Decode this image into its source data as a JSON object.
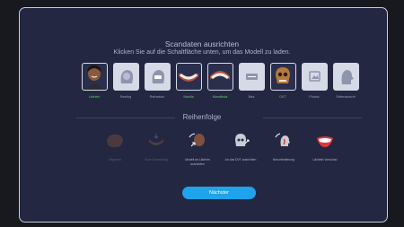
{
  "header": {
    "title": "Scandaten ausrichten",
    "subtitle": "Klicken Sie auf die Schaltfläche unten, um das Modell zu laden."
  },
  "tiles": [
    {
      "label": "Lächeln",
      "color": "#5fd06a",
      "icon": "face-photo-icon"
    },
    {
      "label": "Resting",
      "color": "#9aa0ba",
      "icon": "head-profile-icon"
    },
    {
      "label": "Retraction",
      "color": "#9aa0ba",
      "icon": "retracted-teeth-icon"
    },
    {
      "label": "Maxilla",
      "color": "#5fd06a",
      "icon": "maxilla-scan-icon"
    },
    {
      "label": "Mandibula",
      "color": "#5fd06a",
      "icon": "mandibula-scan-icon"
    },
    {
      "label": "Biss",
      "color": "#9aa0ba",
      "icon": "bite-icon"
    },
    {
      "label": "DVT",
      "color": "#5fd06a",
      "icon": "dvt-skull-icon"
    },
    {
      "label": "Photos",
      "color": "#9aa0ba",
      "icon": "photo-icon"
    },
    {
      "label": "Seitenansicht",
      "color": "#9aa0ba",
      "icon": "side-view-icon"
    }
  ],
  "order": {
    "title": "Reihenfolge",
    "steps": [
      {
        "label": "Segment",
        "dim": true,
        "icon": "segment-icon"
      },
      {
        "label": "Scan Einrichtung",
        "dim": true,
        "icon": "scan-setup-icon"
      },
      {
        "label": "Modell an Lächeln ausrichten",
        "dim": false,
        "icon": "align-to-smile-icon"
      },
      {
        "label": "An das DVT ausrichten",
        "dim": false,
        "icon": "align-to-dvt-icon"
      },
      {
        "label": "Neuorientierung",
        "dim": false,
        "icon": "reorient-icon"
      },
      {
        "label": "Lächeln Vorschau",
        "dim": false,
        "icon": "smile-preview-icon"
      }
    ]
  },
  "next_button": "Nächster"
}
